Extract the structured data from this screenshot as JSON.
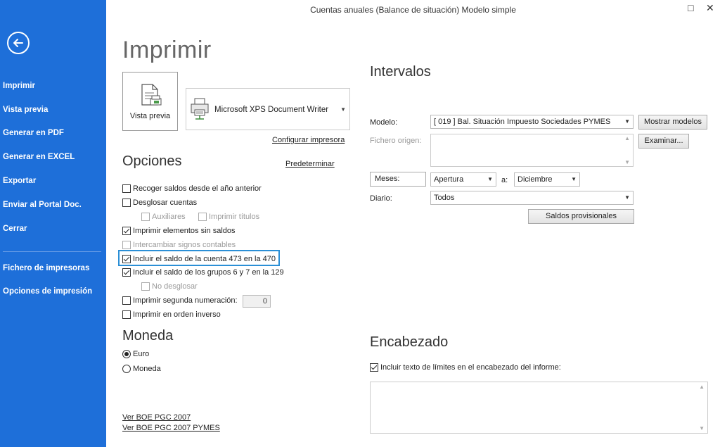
{
  "window": {
    "title": "Cuentas anuales (Balance de situación) Modelo simple",
    "maximize_glyph": "□",
    "close_glyph": "✕"
  },
  "sidebar": {
    "back_icon": "back-arrow-icon",
    "items": [
      {
        "label": "Imprimir"
      },
      {
        "label": "Vista previa"
      },
      {
        "label": "Generar en PDF"
      },
      {
        "label": "Generar en EXCEL"
      },
      {
        "label": "Exportar"
      },
      {
        "label": "Enviar al Portal Doc."
      },
      {
        "label": "Cerrar"
      },
      {
        "label": "Fichero de impresoras"
      },
      {
        "label": "Opciones de impresión"
      }
    ]
  },
  "print": {
    "title": "Imprimir",
    "preview_label": "Vista previa",
    "printer_name": "Microsoft XPS Document Writer",
    "configure_link": "Configurar impresora"
  },
  "options": {
    "title": "Opciones",
    "default_link": "Predeterminar",
    "items": [
      {
        "label": "Recoger saldos desde el año anterior",
        "checked": false,
        "disabled": false
      },
      {
        "label": "Desglosar cuentas",
        "checked": false,
        "disabled": false
      },
      {
        "label": "Auxiliares",
        "checked": false,
        "disabled": true
      },
      {
        "label": "Imprimir títulos",
        "checked": false,
        "disabled": true
      },
      {
        "label": "Imprimir elementos sin saldos",
        "checked": true,
        "disabled": false
      },
      {
        "label": "Intercambiar signos contables",
        "checked": false,
        "disabled": true
      },
      {
        "label": "Incluir el saldo de la cuenta 473 en la 470",
        "checked": true,
        "disabled": false
      },
      {
        "label": "Incluir el saldo de los grupos 6 y 7 en la 129",
        "checked": true,
        "disabled": false
      },
      {
        "label": "No desglosar",
        "checked": false,
        "disabled": true
      },
      {
        "label": "Imprimir segunda numeración:",
        "checked": false,
        "disabled": false
      },
      {
        "label": "Imprimir en orden inverso",
        "checked": false,
        "disabled": false
      }
    ],
    "second_numbering_value": "0"
  },
  "currency": {
    "title": "Moneda",
    "options": [
      {
        "label": "Euro",
        "selected": true
      },
      {
        "label": "Moneda",
        "selected": false
      }
    ]
  },
  "links": {
    "boe_pgc": "Ver BOE PGC 2007",
    "boe_pymes": "Ver BOE PGC 2007 PYMES"
  },
  "intervals": {
    "title": "Intervalos",
    "model_label": "Modelo:",
    "model_value": "[ 019 ] Bal. Situación  Impuesto Sociedades PYMES",
    "show_models_button": "Mostrar modelos",
    "source_file_label": "Fichero origen:",
    "browse_button": "Examinar...",
    "months_label": "Meses:",
    "months_from": "Apertura",
    "to_label": "a:",
    "months_to": "Diciembre",
    "journal_label": "Diario:",
    "journal_value": "Todos",
    "provisional_button": "Saldos provisionales"
  },
  "header_section": {
    "title": "Encabezado",
    "include_limits_label": "Incluir texto de límites en el encabezado del informe:",
    "include_limits_checked": true
  }
}
